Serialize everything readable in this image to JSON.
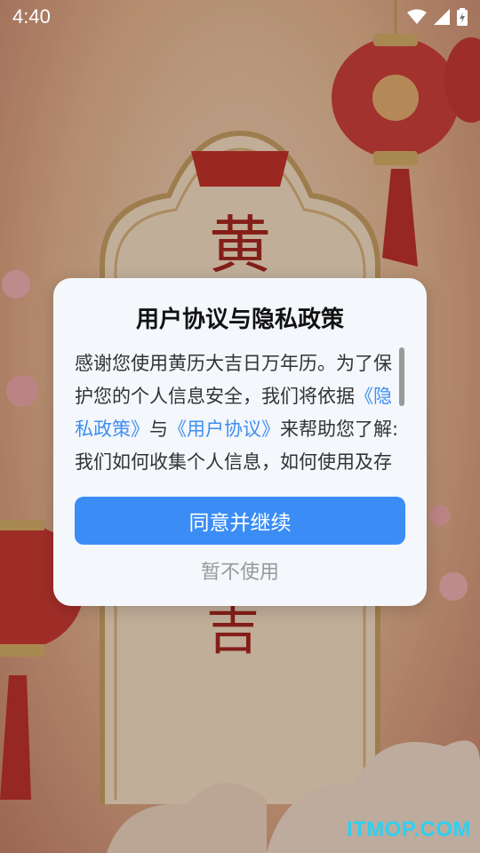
{
  "status_bar": {
    "time": "4:40"
  },
  "dialog": {
    "title": "用户协议与隐私政策",
    "body_text_1": "感谢您使用黄历大吉日万年历。为了保护您的个人信息安全，我们将依据",
    "privacy_link": "《隐私政策》",
    "body_text_2": "与",
    "agreement_link": "《用户协议》",
    "body_text_3": "来帮助您了解:我们如何收集个人信息，如何使用及存储个人信息，以及您享有",
    "agree_label": "同意并继续",
    "decline_label": "暂不使用"
  },
  "watermark": "ITMOP.COM",
  "colors": {
    "accent": "#3b8df5",
    "link": "#3d8ff0"
  }
}
